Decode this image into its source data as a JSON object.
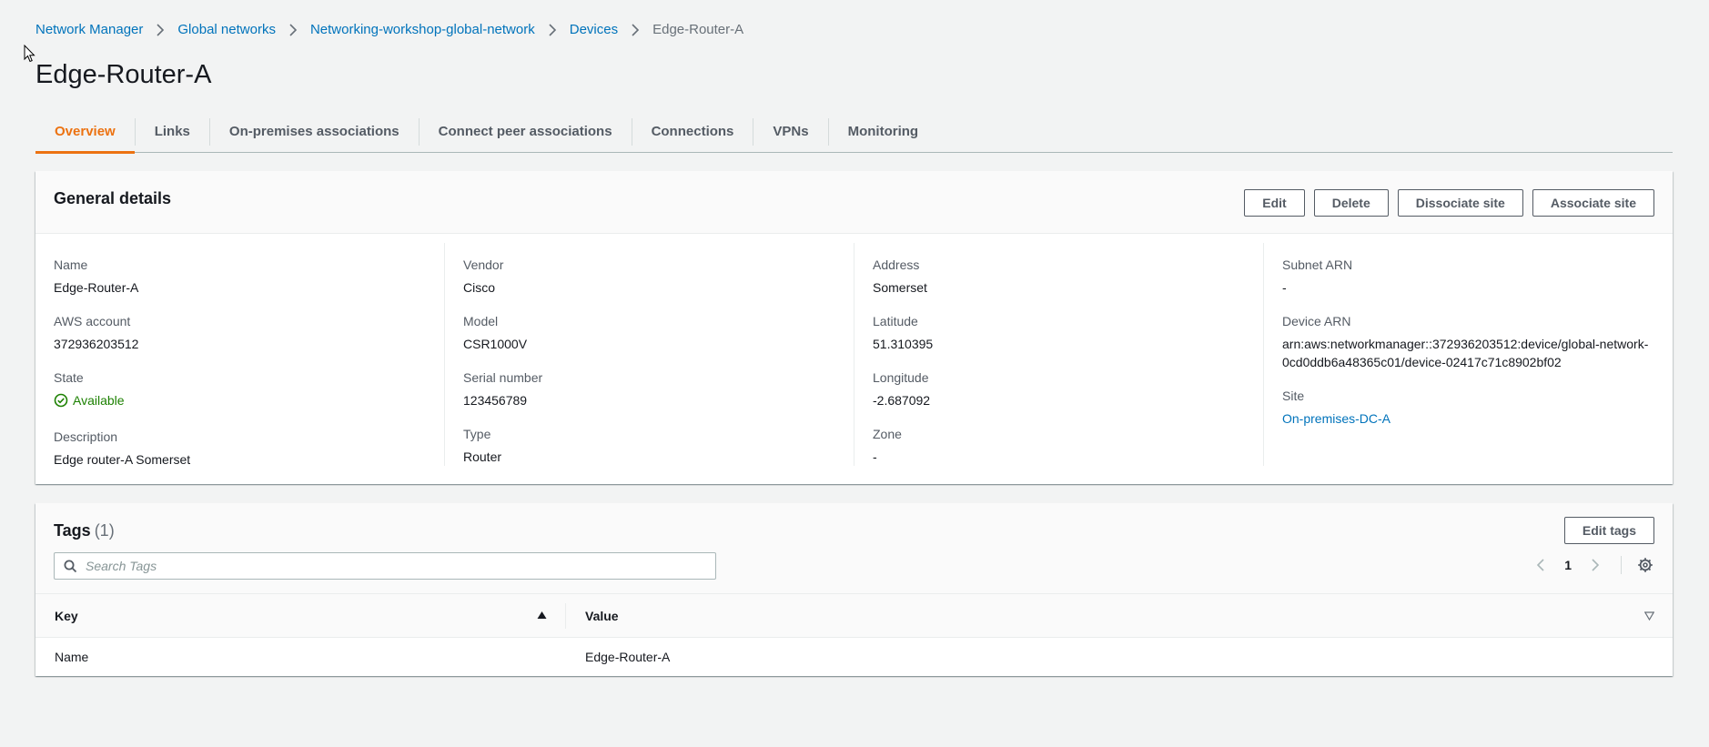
{
  "breadcrumb": {
    "items": [
      {
        "label": "Network Manager"
      },
      {
        "label": "Global networks"
      },
      {
        "label": "Networking-workshop-global-network"
      },
      {
        "label": "Devices"
      },
      {
        "label": "Edge-Router-A"
      }
    ]
  },
  "page": {
    "title": "Edge-Router-A"
  },
  "tabs": [
    {
      "label": "Overview"
    },
    {
      "label": "Links"
    },
    {
      "label": "On-premises associations"
    },
    {
      "label": "Connect peer associations"
    },
    {
      "label": "Connections"
    },
    {
      "label": "VPNs"
    },
    {
      "label": "Monitoring"
    }
  ],
  "general": {
    "title": "General details",
    "actions": {
      "edit": "Edit",
      "delete": "Delete",
      "dissociate": "Dissociate site",
      "associate": "Associate site"
    },
    "col1": {
      "name_label": "Name",
      "name_value": "Edge-Router-A",
      "account_label": "AWS account",
      "account_value": "372936203512",
      "state_label": "State",
      "state_value": "Available",
      "description_label": "Description",
      "description_value": "Edge router-A Somerset"
    },
    "col2": {
      "vendor_label": "Vendor",
      "vendor_value": "Cisco",
      "model_label": "Model",
      "model_value": "CSR1000V",
      "serial_label": "Serial number",
      "serial_value": "123456789",
      "type_label": "Type",
      "type_value": "Router"
    },
    "col3": {
      "address_label": "Address",
      "address_value": "Somerset",
      "latitude_label": "Latitude",
      "latitude_value": "51.310395",
      "longitude_label": "Longitude",
      "longitude_value": "-2.687092",
      "zone_label": "Zone",
      "zone_value": "-"
    },
    "col4": {
      "subnet_label": "Subnet ARN",
      "subnet_value": "-",
      "device_arn_label": "Device ARN",
      "device_arn_value": "arn:aws:networkmanager::372936203512:device/global-network-0cd0ddb6a48365c01/device-02417c71c8902bf02",
      "site_label": "Site",
      "site_value": "On-premises-DC-A"
    }
  },
  "tags": {
    "title": "Tags",
    "count": "(1)",
    "edit_label": "Edit tags",
    "search_placeholder": "Search Tags",
    "page_number": "1",
    "columns": {
      "key": "Key",
      "value": "Value"
    },
    "rows": [
      {
        "key": "Name",
        "value": "Edge-Router-A"
      }
    ]
  },
  "colors": {
    "accent": "#ec7211",
    "link": "#0073bb",
    "success": "#1d8102"
  },
  "icons": {
    "breadcrumb_separator": "chevron-right-icon",
    "state": "check-circle-icon",
    "search": "search-icon",
    "prev": "chevron-left-icon",
    "next": "chevron-right-icon",
    "settings": "gear-icon",
    "sort_asc": "sort-ascending-icon",
    "sort_none": "sort-descending-outline-icon"
  }
}
